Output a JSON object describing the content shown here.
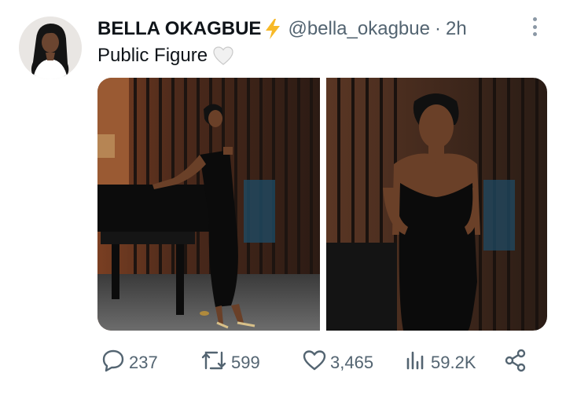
{
  "tweet": {
    "display_name": "BELLA OKAGBUE",
    "verified_emoji": "lightning-bolt-icon",
    "handle": "@bella_okagbue",
    "separator": "·",
    "time": "2h",
    "bio": "Public Figure",
    "bio_emoji": "white-heart-icon",
    "media": [
      {
        "name": "photo-piano-pose"
      },
      {
        "name": "photo-closeup-pose"
      }
    ]
  },
  "actions": {
    "reply_count": "237",
    "retweet_count": "599",
    "like_count": "3,465",
    "view_count": "59.2K"
  },
  "colors": {
    "text": "#0f1419",
    "muted": "#536471",
    "bolt": "#f7b928"
  }
}
